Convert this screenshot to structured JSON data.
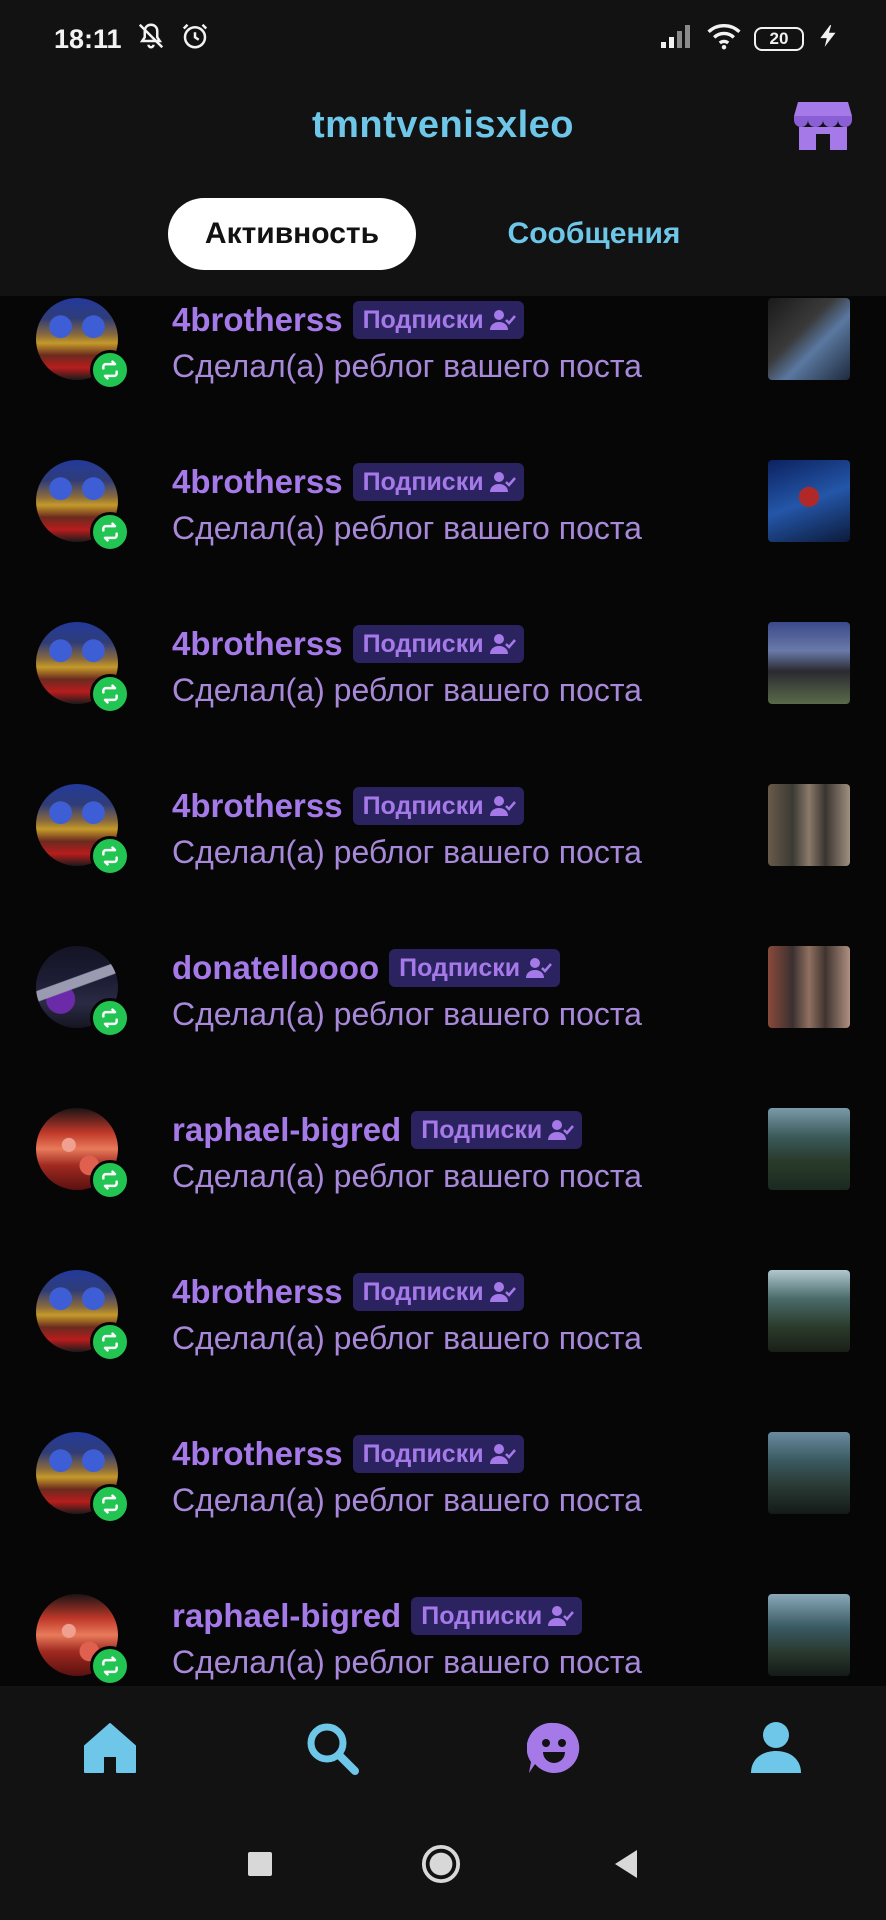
{
  "status_bar": {
    "time": "18:11",
    "battery": "20"
  },
  "header": {
    "title": "tmntvenisxleo",
    "tabs": [
      {
        "label": "Активность",
        "active": true
      },
      {
        "label": "Сообщения",
        "active": false
      }
    ]
  },
  "activity": {
    "follow_badge_label": "Подписки",
    "description": "Сделал(а) реблог вашего поста",
    "items": [
      {
        "username": "4brotherss",
        "avatar": "4brotherss",
        "action_icon": "reblog-icon"
      },
      {
        "username": "4brotherss",
        "avatar": "4brotherss",
        "action_icon": "reblog-icon"
      },
      {
        "username": "4brotherss",
        "avatar": "4brotherss",
        "action_icon": "reblog-icon"
      },
      {
        "username": "4brotherss",
        "avatar": "4brotherss",
        "action_icon": "reblog-icon"
      },
      {
        "username": "donatelloooo",
        "avatar": "donatelloooo",
        "action_icon": "reblog-icon"
      },
      {
        "username": "raphael-bigred",
        "avatar": "raphael-bigred",
        "action_icon": "reblog-icon"
      },
      {
        "username": "4brotherss",
        "avatar": "4brotherss",
        "action_icon": "reblog-icon"
      },
      {
        "username": "4brotherss",
        "avatar": "4brotherss",
        "action_icon": "reblog-icon"
      },
      {
        "username": "raphael-bigred",
        "avatar": "raphael-bigred",
        "action_icon": "reblog-icon"
      }
    ]
  },
  "bottom_nav": {
    "items": [
      {
        "icon": "home-icon",
        "active": true
      },
      {
        "icon": "search-icon",
        "active": false
      },
      {
        "icon": "activity-face-icon",
        "active": false
      },
      {
        "icon": "account-icon",
        "active": false
      }
    ]
  },
  "colors": {
    "accent_blue": "#6ec7e8",
    "accent_purple": "#a57ae8",
    "reblog_green": "#23c552",
    "badge_bg": "#2a2360"
  }
}
